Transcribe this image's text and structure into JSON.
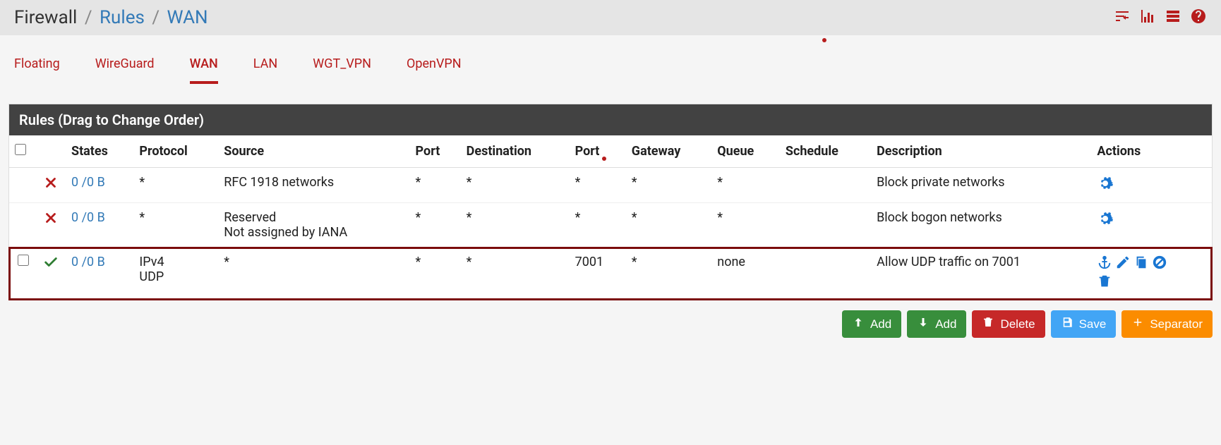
{
  "breadcrumb": {
    "root": "Firewall",
    "mid": "Rules",
    "leaf": "WAN"
  },
  "tabs": [
    "Floating",
    "WireGuard",
    "WAN",
    "LAN",
    "WGT_VPN",
    "OpenVPN"
  ],
  "active_tab": "WAN",
  "panel_title": "Rules (Drag to Change Order)",
  "columns": {
    "states": "States",
    "protocol": "Protocol",
    "source": "Source",
    "sport": "Port",
    "destination": "Destination",
    "dport": "Port",
    "gateway": "Gateway",
    "queue": "Queue",
    "schedule": "Schedule",
    "description": "Description",
    "actions": "Actions"
  },
  "rows": [
    {
      "status_icon": "block",
      "checkbox": false,
      "states": "0 /0 B",
      "protocol": "*",
      "source": "RFC 1918 networks",
      "sport": "*",
      "destination": "*",
      "dport": "*",
      "gateway": "*",
      "queue": "*",
      "schedule": "",
      "description": "Block private networks",
      "actions": [
        "gear"
      ]
    },
    {
      "status_icon": "block",
      "checkbox": false,
      "states": "0 /0 B",
      "protocol": "*",
      "source": "Reserved\nNot assigned by IANA",
      "sport": "*",
      "destination": "*",
      "dport": "*",
      "gateway": "*",
      "queue": "*",
      "schedule": "",
      "description": "Block bogon networks",
      "actions": [
        "gear"
      ]
    },
    {
      "status_icon": "pass",
      "checkbox": true,
      "highlight": true,
      "states": "0 /0 B",
      "protocol": "IPv4 UDP",
      "source": "*",
      "sport": "*",
      "destination": "*",
      "dport": "7001",
      "gateway": "*",
      "queue": "none",
      "schedule": "",
      "description": "Allow UDP traffic on 7001",
      "actions": [
        "anchor",
        "edit",
        "copy",
        "disable",
        "delete"
      ]
    }
  ],
  "buttons": {
    "add_up": "Add",
    "add_down": "Add",
    "delete": "Delete",
    "save": "Save",
    "separator": "Separator"
  }
}
